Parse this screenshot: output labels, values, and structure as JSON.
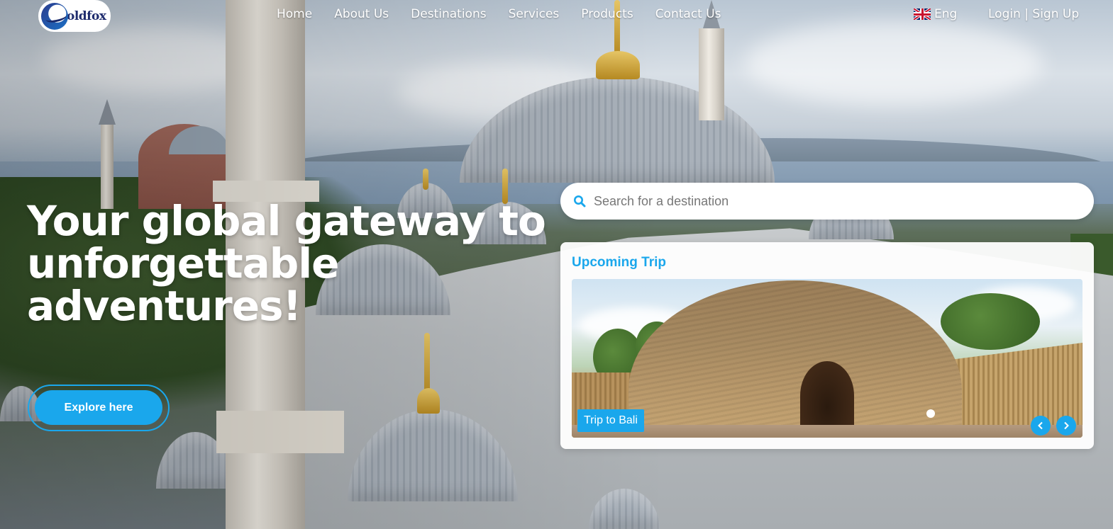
{
  "brand": {
    "name": "oldfox"
  },
  "nav": {
    "links": [
      "Home",
      "About Us",
      "Destinations",
      "Services",
      "Products",
      "Contact Us"
    ],
    "language": "Eng",
    "login": "Login",
    "separator": " | ",
    "signup": "Sign Up"
  },
  "hero": {
    "title_line1": "Your global gateway to",
    "title_line2": "unforgettable",
    "title_line3": "adventures!",
    "cta": "Explore here"
  },
  "search": {
    "placeholder": "Search for a destination",
    "icon": "search-icon"
  },
  "upcoming": {
    "title": "Upcoming Trip",
    "slide_caption": "Trip to Bali",
    "prev_icon": "chevron-left-icon",
    "next_icon": "chevron-right-icon"
  },
  "colors": {
    "accent": "#1aa7ec",
    "text_light": "#ffffff"
  }
}
